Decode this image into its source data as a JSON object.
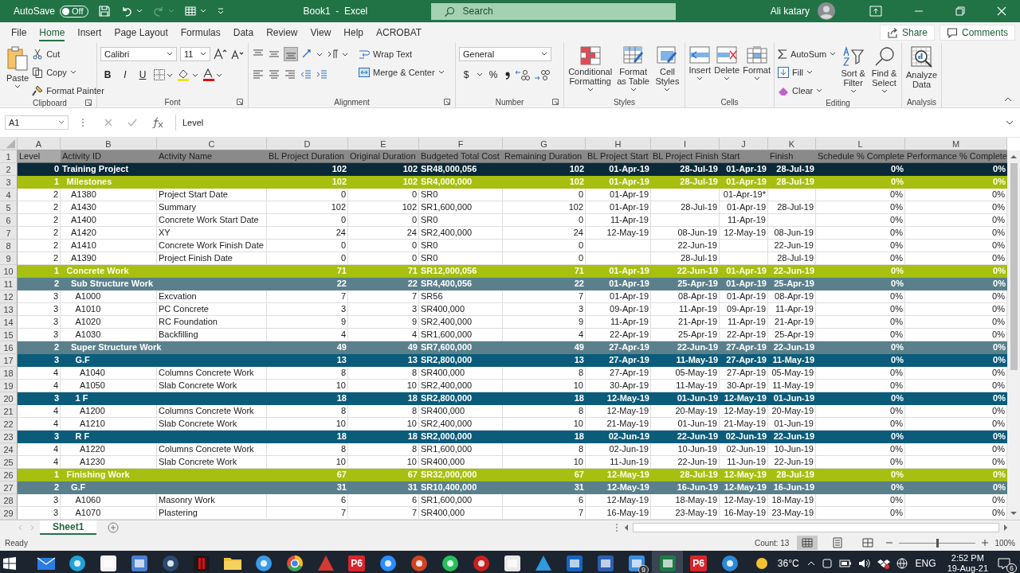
{
  "title_bar": {
    "autosave_label": "AutoSave",
    "autosave": {
      "label": "Off",
      "on": false
    },
    "title": "Book1  -  Excel",
    "search": {
      "placeholder": "Search"
    },
    "user": "Ali katary"
  },
  "menu_tabs": [
    {
      "label": "File",
      "selected": false
    },
    {
      "label": "Home",
      "selected": true
    },
    {
      "label": "Insert",
      "selected": false
    },
    {
      "label": "Page Layout",
      "selected": false
    },
    {
      "label": "Formulas",
      "selected": false
    },
    {
      "label": "Data",
      "selected": false
    },
    {
      "label": "Review",
      "selected": false
    },
    {
      "label": "View",
      "selected": false
    },
    {
      "label": "Help",
      "selected": false
    },
    {
      "label": "ACROBAT",
      "selected": false
    }
  ],
  "share": "Share",
  "comments": "Comments",
  "ribbon": {
    "clipboard": {
      "label": "Clipboard",
      "paste": "Paste",
      "cut": "Cut",
      "copy": "Copy",
      "format_painter": "Format Painter"
    },
    "font": {
      "label": "Font",
      "font_name": "Calibri",
      "font_size": "11",
      "bold": "B",
      "italic": "I",
      "underline": "U"
    },
    "alignment": {
      "label": "Alignment",
      "wrap_text": "Wrap Text",
      "merge_center": "Merge & Center"
    },
    "number": {
      "label": "Number",
      "format": "General",
      "currency": "$",
      "percent": "%"
    },
    "styles": {
      "label": "Styles",
      "buttons": [
        "Conditional Formatting",
        "Format as Table",
        "Cell Styles"
      ]
    },
    "cells": {
      "label": "Cells",
      "buttons": [
        "Insert",
        "Delete",
        "Format"
      ]
    },
    "editing": {
      "label": "Editing",
      "autosum": "AutoSum",
      "fill": "Fill",
      "clear": "Clear",
      "buttons": [
        "Sort & Filter",
        "Find & Select"
      ]
    },
    "analysis": {
      "label": "Analysis",
      "buttons": [
        "Analyze Data"
      ]
    }
  },
  "formula_bar": {
    "name_box": "A1",
    "value": "Level"
  },
  "sheet": {
    "columns": [
      "A",
      "B",
      "C",
      "D",
      "E",
      "F",
      "G",
      "H",
      "I",
      "J",
      "K",
      "L",
      "M"
    ],
    "rows": [
      {
        "number": "1",
        "kind": "header",
        "cells": [
          "Level",
          "Activity ID",
          "Activity Name",
          "BL Project Duration",
          "Original Duration",
          "Budgeted Total Cost",
          "Remaining Duration",
          "BL Project Start",
          "BL Project Finish",
          "Start",
          "Finish",
          "Schedule % Complete",
          "Performance % Complete"
        ]
      },
      {
        "number": "2",
        "kind": "project",
        "cells": [
          "0",
          "Training Project",
          null,
          "102",
          "102",
          "SR48,000,056",
          "102",
          "01-Apr-19",
          "28-Jul-19",
          "01-Apr-19",
          "28-Jul-19",
          "0%",
          "0%"
        ]
      },
      {
        "number": "3",
        "kind": "wbs-major",
        "cells": [
          "1",
          "Milestones",
          null,
          "102",
          "102",
          "SR4,000,000",
          "102",
          "01-Apr-19",
          "28-Jul-19",
          "01-Apr-19",
          "28-Jul-19",
          "0%",
          "0%"
        ]
      },
      {
        "number": "4",
        "kind": "activity",
        "cells": [
          "2",
          "A1380",
          "Project Start Date",
          "0",
          "0",
          "SR0",
          "0",
          "01-Apr-19",
          null,
          "01-Apr-19*",
          null,
          "0%",
          "0%"
        ]
      },
      {
        "number": "5",
        "kind": "activity",
        "cells": [
          "2",
          "A1430",
          "Summary",
          "102",
          "102",
          "SR1,600,000",
          "102",
          "01-Apr-19",
          "28-Jul-19",
          "01-Apr-19",
          "28-Jul-19",
          "0%",
          "0%"
        ]
      },
      {
        "number": "6",
        "kind": "activity",
        "cells": [
          "2",
          "A1400",
          "Concrete Work Start Date",
          "0",
          "0",
          "SR0",
          "0",
          "11-Apr-19",
          null,
          "11-Apr-19",
          null,
          "0%",
          "0%"
        ]
      },
      {
        "number": "7",
        "kind": "activity",
        "cells": [
          "2",
          "A1420",
          "XY",
          "24",
          "24",
          "SR2,400,000",
          "24",
          "12-May-19",
          "08-Jun-19",
          "12-May-19",
          "08-Jun-19",
          "0%",
          "0%"
        ]
      },
      {
        "number": "8",
        "kind": "activity",
        "cells": [
          "2",
          "A1410",
          "Concrete Work Finish Date",
          "0",
          "0",
          "SR0",
          "0",
          null,
          "22-Jun-19",
          null,
          "22-Jun-19",
          "0%",
          "0%"
        ]
      },
      {
        "number": "9",
        "kind": "activity",
        "cells": [
          "2",
          "A1390",
          "Project Finish Date",
          "0",
          "0",
          "SR0",
          "0",
          null,
          "28-Jul-19",
          null,
          "28-Jul-19",
          "0%",
          "0%"
        ]
      },
      {
        "number": "10",
        "kind": "wbs-major",
        "cells": [
          "1",
          "Concrete Work",
          null,
          "71",
          "71",
          "SR12,000,056",
          "71",
          "01-Apr-19",
          "22-Jun-19",
          "01-Apr-19",
          "22-Jun-19",
          "0%",
          "0%"
        ]
      },
      {
        "number": "11",
        "kind": "wbs-group",
        "cells": [
          "2",
          "Sub Structure Work",
          null,
          "22",
          "22",
          "SR4,400,056",
          "22",
          "01-Apr-19",
          "25-Apr-19",
          "01-Apr-19",
          "25-Apr-19",
          "0%",
          "0%"
        ]
      },
      {
        "number": "12",
        "kind": "activity",
        "cells": [
          "3",
          "A1000",
          "Excvation",
          "7",
          "7",
          "SR56",
          "7",
          "01-Apr-19",
          "08-Apr-19",
          "01-Apr-19",
          "08-Apr-19",
          "0%",
          "0%"
        ]
      },
      {
        "number": "13",
        "kind": "activity",
        "cells": [
          "3",
          "A1010",
          "PC Concrete",
          "3",
          "3",
          "SR400,000",
          "3",
          "09-Apr-19",
          "11-Apr-19",
          "09-Apr-19",
          "11-Apr-19",
          "0%",
          "0%"
        ]
      },
      {
        "number": "14",
        "kind": "activity",
        "cells": [
          "3",
          "A1020",
          "RC Foundation",
          "9",
          "9",
          "SR2,400,000",
          "9",
          "11-Apr-19",
          "21-Apr-19",
          "11-Apr-19",
          "21-Apr-19",
          "0%",
          "0%"
        ]
      },
      {
        "number": "15",
        "kind": "activity",
        "cells": [
          "3",
          "A1030",
          "Backfilling",
          "4",
          "4",
          "SR1,600,000",
          "4",
          "22-Apr-19",
          "25-Apr-19",
          "22-Apr-19",
          "25-Apr-19",
          "0%",
          "0%"
        ]
      },
      {
        "number": "16",
        "kind": "wbs-group",
        "cells": [
          "2",
          "Super Structure Work",
          null,
          "49",
          "49",
          "SR7,600,000",
          "49",
          "27-Apr-19",
          "22-Jun-19",
          "27-Apr-19",
          "22-Jun-19",
          "0%",
          "0%"
        ]
      },
      {
        "number": "17",
        "kind": "wbs-sub",
        "cells": [
          "3",
          "G.F",
          null,
          "13",
          "13",
          "SR2,800,000",
          "13",
          "27-Apr-19",
          "11-May-19",
          "27-Apr-19",
          "11-May-19",
          "0%",
          "0%"
        ]
      },
      {
        "number": "18",
        "kind": "activity",
        "cells": [
          "4",
          "A1040",
          "Columns Concrete Work",
          "8",
          "8",
          "SR400,000",
          "8",
          "27-Apr-19",
          "05-May-19",
          "27-Apr-19",
          "05-May-19",
          "0%",
          "0%"
        ]
      },
      {
        "number": "19",
        "kind": "activity",
        "cells": [
          "4",
          "A1050",
          "Slab Concrete Work",
          "10",
          "10",
          "SR2,400,000",
          "10",
          "30-Apr-19",
          "11-May-19",
          "30-Apr-19",
          "11-May-19",
          "0%",
          "0%"
        ]
      },
      {
        "number": "20",
        "kind": "wbs-sub",
        "cells": [
          "3",
          "1 F",
          null,
          "18",
          "18",
          "SR2,800,000",
          "18",
          "12-May-19",
          "01-Jun-19",
          "12-May-19",
          "01-Jun-19",
          "0%",
          "0%"
        ]
      },
      {
        "number": "21",
        "kind": "activity",
        "cells": [
          "4",
          "A1200",
          "Columns Concrete Work",
          "8",
          "8",
          "SR400,000",
          "8",
          "12-May-19",
          "20-May-19",
          "12-May-19",
          "20-May-19",
          "0%",
          "0%"
        ]
      },
      {
        "number": "22",
        "kind": "activity",
        "cells": [
          "4",
          "A1210",
          "Slab Concrete Work",
          "10",
          "10",
          "SR2,400,000",
          "10",
          "21-May-19",
          "01-Jun-19",
          "21-May-19",
          "01-Jun-19",
          "0%",
          "0%"
        ]
      },
      {
        "number": "23",
        "kind": "wbs-sub",
        "cells": [
          "3",
          "R F",
          null,
          "18",
          "18",
          "SR2,000,000",
          "18",
          "02-Jun-19",
          "22-Jun-19",
          "02-Jun-19",
          "22-Jun-19",
          "0%",
          "0%"
        ]
      },
      {
        "number": "24",
        "kind": "activity",
        "cells": [
          "4",
          "A1220",
          "Columns Concrete Work",
          "8",
          "8",
          "SR1,600,000",
          "8",
          "02-Jun-19",
          "10-Jun-19",
          "02-Jun-19",
          "10-Jun-19",
          "0%",
          "0%"
        ]
      },
      {
        "number": "25",
        "kind": "activity",
        "cells": [
          "4",
          "A1230",
          "Slab Concrete Work",
          "10",
          "10",
          "SR400,000",
          "10",
          "11-Jun-19",
          "22-Jun-19",
          "11-Jun-19",
          "22-Jun-19",
          "0%",
          "0%"
        ]
      },
      {
        "number": "26",
        "kind": "wbs-major",
        "cells": [
          "1",
          "Finishing Work",
          null,
          "67",
          "67",
          "SR32,000,000",
          "67",
          "12-May-19",
          "28-Jul-19",
          "12-May-19",
          "28-Jul-19",
          "0%",
          "0%"
        ]
      },
      {
        "number": "27",
        "kind": "wbs-group",
        "cells": [
          "2",
          "G.F",
          null,
          "31",
          "31",
          "SR10,400,000",
          "31",
          "12-May-19",
          "16-Jun-19",
          "12-May-19",
          "16-Jun-19",
          "0%",
          "0%"
        ]
      },
      {
        "number": "28",
        "kind": "activity",
        "cells": [
          "3",
          "A1060",
          "Masonry Work",
          "6",
          "6",
          "SR1,600,000",
          "6",
          "12-May-19",
          "18-May-19",
          "12-May-19",
          "18-May-19",
          "0%",
          "0%"
        ]
      },
      {
        "number": "29",
        "kind": "activity",
        "cells": [
          "3",
          "A1070",
          "Plastering",
          "7",
          "7",
          "SR400,000",
          "7",
          "16-May-19",
          "23-May-19",
          "16-May-19",
          "23-May-19",
          "0%",
          "0%"
        ]
      }
    ]
  },
  "sheet_tabs": [
    {
      "label": "Sheet1",
      "selected": true
    }
  ],
  "status_bar": {
    "status": "Ready",
    "count": "Count: 13",
    "views": [
      {
        "kind": "normal",
        "selected": true
      },
      {
        "kind": "page-layout",
        "selected": false
      },
      {
        "kind": "page-break",
        "selected": false
      }
    ],
    "zoom": {
      "level": 0.5,
      "reading": "100%"
    }
  },
  "taskbar": {
    "apps": [
      {
        "kind": "mail",
        "selected": false
      },
      {
        "kind": "browser",
        "selected": false
      },
      {
        "kind": "shop",
        "selected": false
      },
      {
        "kind": "calculator",
        "selected": false
      },
      {
        "kind": "game",
        "selected": false
      },
      {
        "kind": "video",
        "selected": false
      },
      {
        "kind": "folder",
        "selected": false
      },
      {
        "kind": "round",
        "selected": false
      },
      {
        "kind": "browser2",
        "selected": false
      },
      {
        "kind": "triangle",
        "selected": false
      },
      {
        "kind": "p6",
        "label": "P6",
        "selected": false
      },
      {
        "kind": "camera",
        "selected": false
      },
      {
        "kind": "slides",
        "selected": false
      },
      {
        "kind": "chat",
        "selected": false
      },
      {
        "kind": "record",
        "selected": false
      },
      {
        "kind": "store",
        "selected": false
      },
      {
        "kind": "bolt",
        "selected": false
      },
      {
        "kind": "mail2",
        "selected": false
      },
      {
        "kind": "doc",
        "selected": false
      },
      {
        "kind": "files",
        "badge": "9",
        "selected": false
      },
      {
        "kind": "sheet",
        "selected": true
      },
      {
        "kind": "p6",
        "label": "P6",
        "selected": false
      },
      {
        "kind": "help",
        "selected": false
      }
    ],
    "weather": "36°C",
    "language": "ENG",
    "time": "2:52 PM",
    "date": "19-Aug-21",
    "notifications": "6"
  }
}
